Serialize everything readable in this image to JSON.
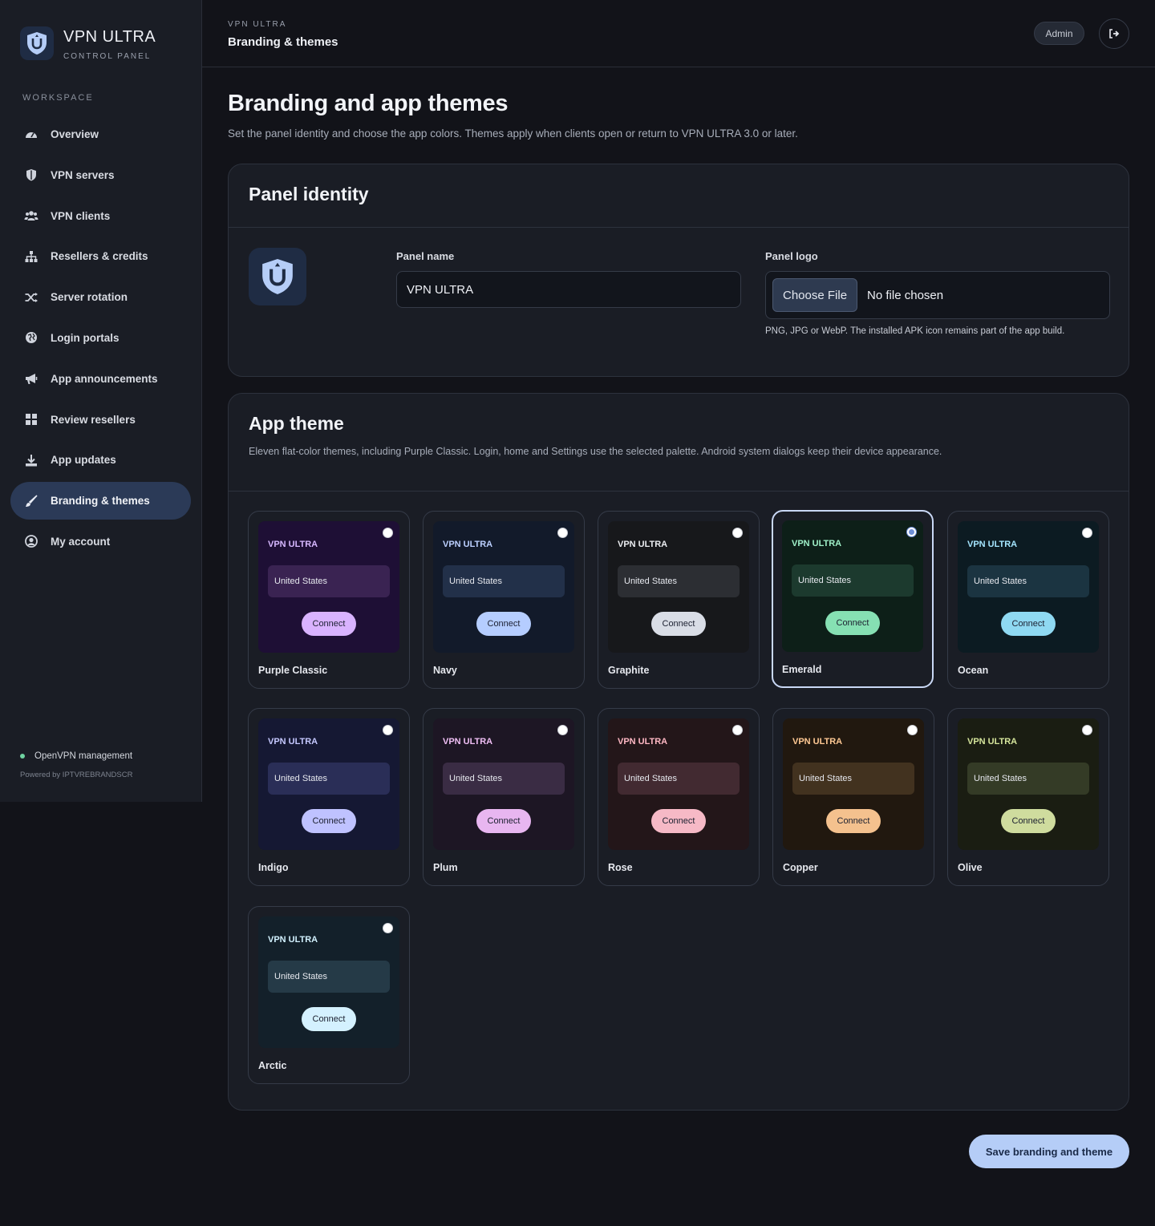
{
  "sidebar": {
    "brand_title": "VPN ULTRA",
    "brand_sub": "CONTROL PANEL",
    "section_label": "WORKSPACE",
    "items": [
      {
        "label": "Overview",
        "icon": "dashboard-gauge-icon"
      },
      {
        "label": "VPN servers",
        "icon": "shield-icon"
      },
      {
        "label": "VPN clients",
        "icon": "users-icon"
      },
      {
        "label": "Resellers & credits",
        "icon": "sitemap-icon"
      },
      {
        "label": "Server rotation",
        "icon": "shuffle-icon"
      },
      {
        "label": "Login portals",
        "icon": "globe-icon"
      },
      {
        "label": "App announcements",
        "icon": "megaphone-icon"
      },
      {
        "label": "Review resellers",
        "icon": "grid-icon"
      },
      {
        "label": "App updates",
        "icon": "download-icon"
      },
      {
        "label": "Branding & themes",
        "icon": "paintbrush-icon",
        "active": true
      },
      {
        "label": "My account",
        "icon": "user-circle-icon"
      }
    ],
    "status": "OpenVPN management",
    "powered": "Powered by IPTVREBRANDSCR"
  },
  "topbar": {
    "crumb": "VPN ULTRA",
    "title": "Branding & themes",
    "user_chip": "Admin",
    "logout_icon": "sign-out-icon"
  },
  "page": {
    "title": "Branding and app themes",
    "description": "Set the panel identity and choose the app colors. Themes apply when clients open or return to VPN ULTRA 3.0 or later."
  },
  "identity": {
    "heading": "Panel identity",
    "name_label": "Panel name",
    "name_value": "VPN ULTRA",
    "logo_label": "Panel logo",
    "file_button": "Choose File",
    "file_status": "No file chosen",
    "file_hint": "PNG, JPG or WebP. The installed APK icon remains part of the app build."
  },
  "theme": {
    "heading": "App theme",
    "description": "Eleven flat-color themes, including Purple Classic. Login, home and Settings use the selected palette. Android system dialogs keep their device appearance.",
    "preview_brand": "VPN ULTRA",
    "preview_country": "United States",
    "preview_connect": "Connect",
    "selected": "Emerald",
    "themes": [
      {
        "name": "Purple Classic",
        "bg": "#1e0f35",
        "brand": "#d7b8ff",
        "panel": "#3a2352",
        "button": "#d9b3ff"
      },
      {
        "name": "Navy",
        "bg": "#121a2a",
        "brand": "#bcd0ff",
        "panel": "#223049",
        "button": "#b5cdff"
      },
      {
        "name": "Graphite",
        "bg": "#17181b",
        "brand": "#eceef2",
        "panel": "#2c2e33",
        "button": "#d9dde6"
      },
      {
        "name": "Emerald",
        "bg": "#0d1f18",
        "brand": "#9ff0c8",
        "panel": "#1c3a2e",
        "button": "#86e0b3"
      },
      {
        "name": "Ocean",
        "bg": "#0c1b22",
        "brand": "#a5e6ff",
        "panel": "#1b3441",
        "button": "#8fd9f2"
      },
      {
        "name": "Indigo",
        "bg": "#151833",
        "brand": "#c5c8ff",
        "panel": "#2a2e57",
        "button": "#bfc2ff"
      },
      {
        "name": "Plum",
        "bg": "#1d1624",
        "brand": "#f0bff5",
        "panel": "#3a2c44",
        "button": "#e8b6f0"
      },
      {
        "name": "Rose",
        "bg": "#231619",
        "brand": "#ffb8c4",
        "panel": "#422a31",
        "button": "#f6b9c6"
      },
      {
        "name": "Copper",
        "bg": "#21180f",
        "brand": "#ffc994",
        "panel": "#42321f",
        "button": "#f4c18e"
      },
      {
        "name": "Olive",
        "bg": "#1a1d12",
        "brand": "#d6e69c",
        "panel": "#343b26",
        "button": "#cfdc9e"
      },
      {
        "name": "Arctic",
        "bg": "#13202a",
        "brand": "#d2f1ff",
        "panel": "#253a47",
        "button": "#d4f1ff"
      }
    ]
  },
  "save_button": "Save branding and theme"
}
